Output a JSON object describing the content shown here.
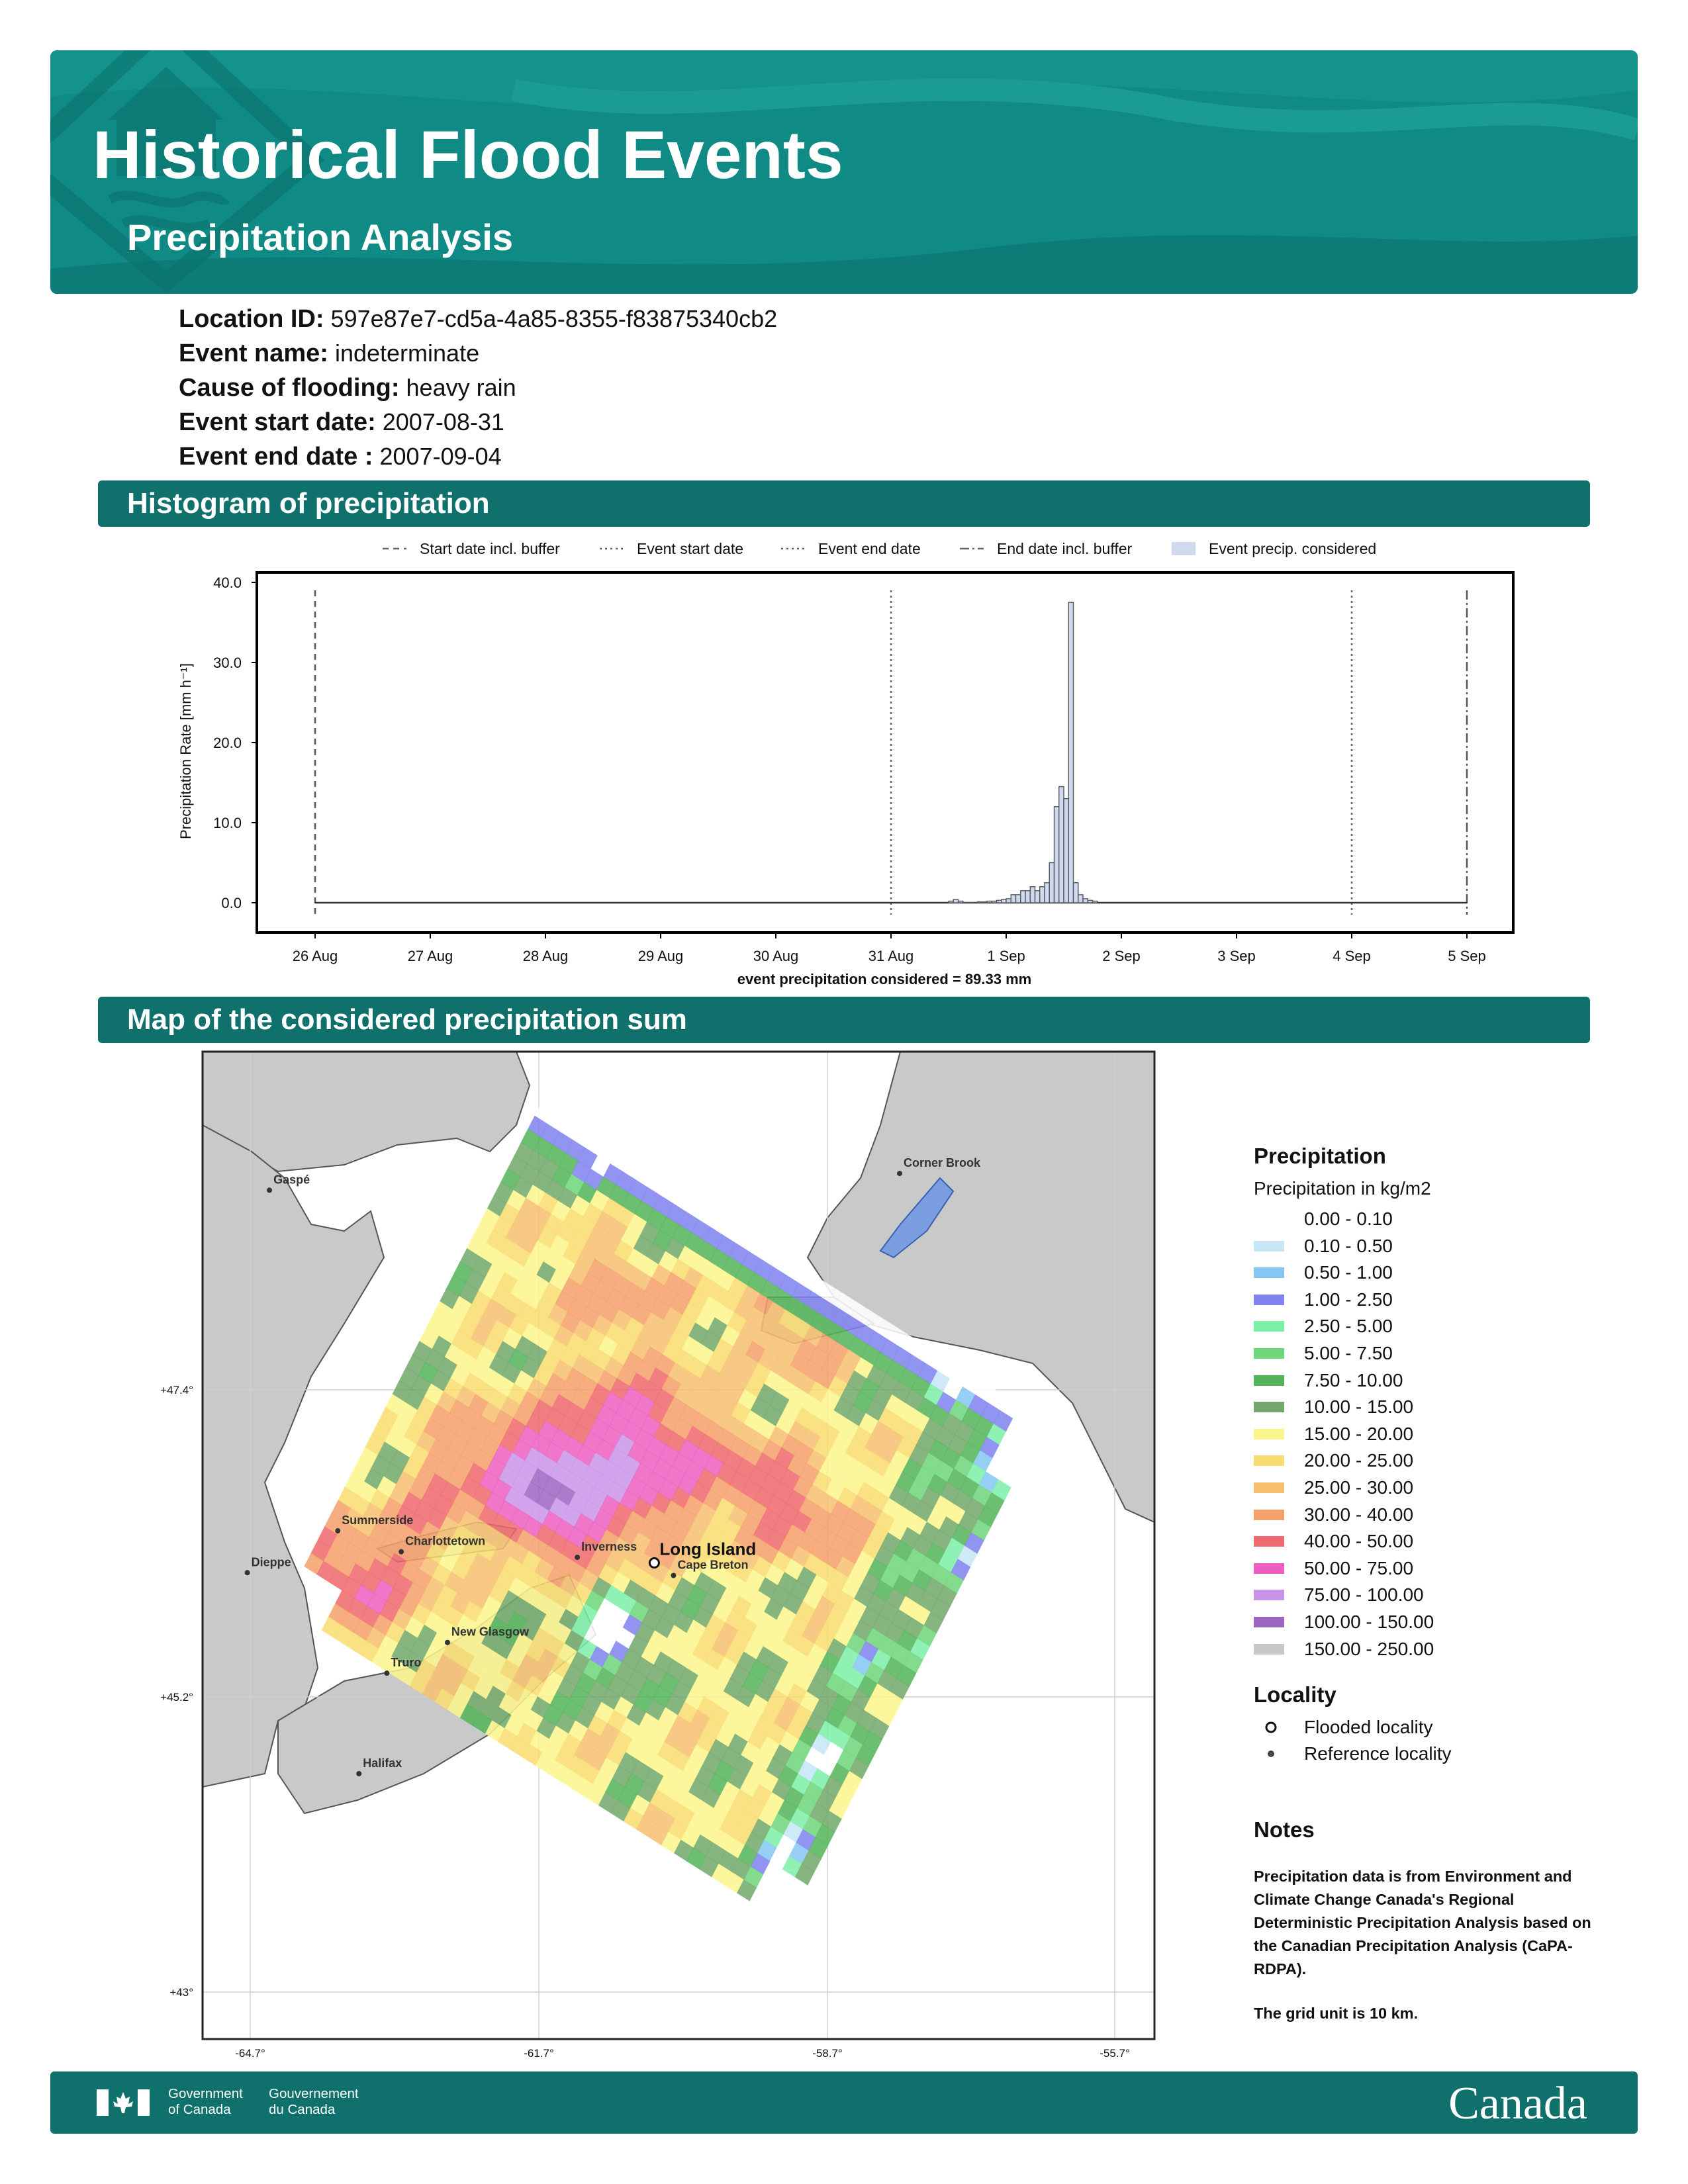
{
  "header": {
    "title": "Historical Flood Events",
    "subtitle": "Precipitation Analysis",
    "icon": "house-water-icon"
  },
  "info": {
    "location_id": {
      "label": "Location ID:",
      "value": "597e87e7-cd5a-4a85-8355-f83875340cb2"
    },
    "event_name": {
      "label": "Event name:",
      "value": "indeterminate"
    },
    "cause": {
      "label": "Cause of flooding:",
      "value": "heavy rain"
    },
    "start": {
      "label": "Event start date:",
      "value": "2007-08-31"
    },
    "end": {
      "label": "Event end date :",
      "value": "2007-09-04"
    }
  },
  "sections": {
    "histogram": "Histogram of precipitation",
    "map": "Map of the considered precipitation sum"
  },
  "chart_data": [
    {
      "type": "area",
      "title": "",
      "xlabel": "event precipitation considered = 89.33 mm",
      "ylabel": "Precipitation Rate [mm h⁻¹]",
      "ylim": [
        0,
        40
      ],
      "yticks": [
        "0.0",
        "10.0",
        "20.0",
        "30.0",
        "40.0"
      ],
      "xticks": [
        "26 Aug",
        "27 Aug",
        "28 Aug",
        "29 Aug",
        "30 Aug",
        "31 Aug",
        "1 Sep",
        "2 Sep",
        "3 Sep",
        "4 Sep",
        "5 Sep"
      ],
      "grid": false,
      "legend_position": "top",
      "legend": [
        {
          "label": "Start date incl. buffer",
          "style": "dashed"
        },
        {
          "label": "Event start date",
          "style": "dotted"
        },
        {
          "label": "Event end date",
          "style": "dotted"
        },
        {
          "label": "End date incl. buffer",
          "style": "dashdot"
        },
        {
          "label": "Event precip. considered",
          "style": "fill"
        }
      ],
      "markers": [
        {
          "name": "Start date incl. buffer",
          "x": "2007-08-26T00:00"
        },
        {
          "name": "Event start date",
          "x": "2007-08-31T00:00"
        },
        {
          "name": "Event end date",
          "x": "2007-09-04T00:00"
        },
        {
          "name": "End date incl. buffer",
          "x": "2007-09-05T00:00"
        }
      ],
      "series": [
        {
          "name": "Event precip. considered",
          "x": [
            "2007-08-31T12:00",
            "2007-08-31T13:00",
            "2007-08-31T14:00",
            "2007-08-31T15:00",
            "2007-08-31T16:00",
            "2007-08-31T17:00",
            "2007-08-31T18:00",
            "2007-08-31T19:00",
            "2007-08-31T20:00",
            "2007-08-31T21:00",
            "2007-08-31T22:00",
            "2007-08-31T23:00",
            "2007-09-01T00:00",
            "2007-09-01T01:00",
            "2007-09-01T02:00",
            "2007-09-01T03:00",
            "2007-09-01T04:00",
            "2007-09-01T05:00",
            "2007-09-01T06:00",
            "2007-09-01T07:00",
            "2007-09-01T08:00",
            "2007-09-01T09:00",
            "2007-09-01T10:00",
            "2007-09-01T11:00",
            "2007-09-01T12:00",
            "2007-09-01T13:00",
            "2007-09-01T14:00",
            "2007-09-01T15:00",
            "2007-09-01T16:00",
            "2007-09-01T17:00",
            "2007-09-01T18:00"
          ],
          "values": [
            0.2,
            0.4,
            0.2,
            0.0,
            0.0,
            0.0,
            0.1,
            0.1,
            0.2,
            0.2,
            0.3,
            0.4,
            0.5,
            1.0,
            1.0,
            1.5,
            1.5,
            2.0,
            1.5,
            2.0,
            2.5,
            5.0,
            12.0,
            14.5,
            13.0,
            37.5,
            2.5,
            1.0,
            0.5,
            0.3,
            0.2
          ]
        }
      ]
    },
    {
      "type": "heatmap",
      "title": "",
      "x_ticks": [
        "-64.7°",
        "-61.7°",
        "-58.7°",
        "-55.7°"
      ],
      "y_ticks": [
        "+47.4°",
        "+45.2°",
        "+43°"
      ],
      "grid": true,
      "places": [
        {
          "name": "Gaspé",
          "lon": -64.5,
          "lat": 48.83,
          "type": "reference"
        },
        {
          "name": "Corner Brook",
          "lon": -57.95,
          "lat": 48.95,
          "type": "reference"
        },
        {
          "name": "Summerside",
          "lon": -63.79,
          "lat": 46.39,
          "type": "reference"
        },
        {
          "name": "Charlottetown",
          "lon": -63.13,
          "lat": 46.24,
          "type": "reference"
        },
        {
          "name": "Dieppe",
          "lon": -64.73,
          "lat": 46.09,
          "type": "reference"
        },
        {
          "name": "Inverness",
          "lon": -61.3,
          "lat": 46.2,
          "type": "reference"
        },
        {
          "name": "Long Island",
          "lon": -60.5,
          "lat": 46.16,
          "type": "flooded"
        },
        {
          "name": "Cape Breton",
          "lon": -60.3,
          "lat": 46.07,
          "type": "reference"
        },
        {
          "name": "New Glasgow",
          "lon": -62.65,
          "lat": 45.59,
          "type": "reference"
        },
        {
          "name": "Truro",
          "lon": -63.28,
          "lat": 45.37,
          "type": "reference"
        },
        {
          "name": "Halifax",
          "lon": -63.57,
          "lat": 44.65,
          "type": "reference"
        }
      ]
    }
  ],
  "legend": {
    "title": "Precipitation",
    "subtitle": "Precipitation in kg/m2",
    "items": [
      {
        "label": "0.00 - 0.10",
        "color": "#ffffff"
      },
      {
        "label": "0.10 - 0.50",
        "color": "#c6e6f8"
      },
      {
        "label": "0.50 - 1.00",
        "color": "#86c7f2"
      },
      {
        "label": "1.00 - 2.50",
        "color": "#7f84ef"
      },
      {
        "label": "2.50 - 5.00",
        "color": "#7df0a8"
      },
      {
        "label": "5.00 - 7.50",
        "color": "#6fd67a"
      },
      {
        "label": "7.50 - 10.00",
        "color": "#54b45a"
      },
      {
        "label": "10.00 - 15.00",
        "color": "#72a96b"
      },
      {
        "label": "15.00 - 20.00",
        "color": "#fbf68c"
      },
      {
        "label": "20.00 - 25.00",
        "color": "#f9dc6f"
      },
      {
        "label": "25.00 - 30.00",
        "color": "#f7c070"
      },
      {
        "label": "30.00 - 40.00",
        "color": "#f59f6a"
      },
      {
        "label": "40.00 - 50.00",
        "color": "#ef6a6e"
      },
      {
        "label": "50.00 - 75.00",
        "color": "#ec5fc0"
      },
      {
        "label": "75.00 - 100.00",
        "color": "#c995e8"
      },
      {
        "label": "100.00 - 150.00",
        "color": "#9c66c2"
      },
      {
        "label": "150.00 - 250.00",
        "color": "#c8c8c8"
      }
    ]
  },
  "locality": {
    "title": "Locality",
    "flooded": "Flooded locality",
    "reference": "Reference locality"
  },
  "notes": {
    "title": "Notes",
    "p1": "Precipitation data is from Environment and Climate Change Canada's Regional Deterministic Precipitation Analysis based on the Canadian Precipitation Analysis (CaPA-RDPA).",
    "p2": "The grid unit is 10 km."
  },
  "footer": {
    "gov_en_1": "Government",
    "gov_en_2": "of Canada",
    "gov_fr_1": "Gouvernement",
    "gov_fr_2": "du Canada",
    "wordmark": "Canada",
    "flag_icon": "canada-flag-icon"
  }
}
